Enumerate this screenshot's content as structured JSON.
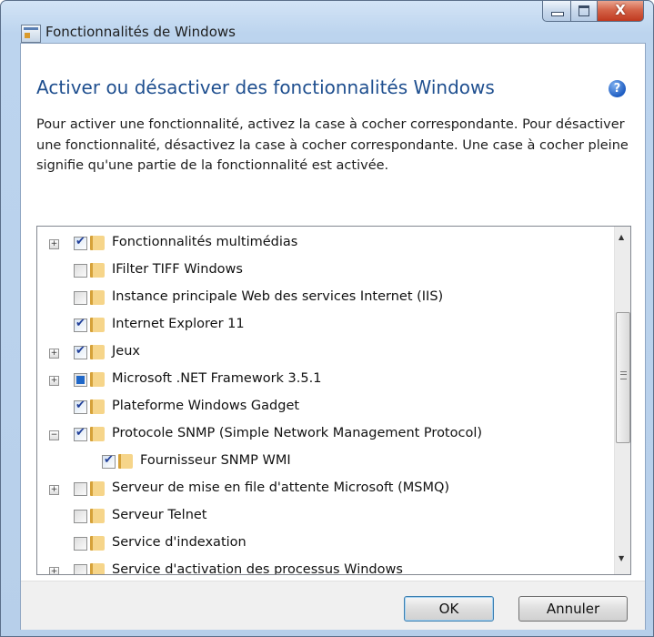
{
  "window": {
    "title": "Fonctionnalités de Windows",
    "close_glyph": "X"
  },
  "heading": "Activer ou désactiver des fonctionnalités Windows",
  "help_glyph": "?",
  "description": "Pour activer une fonctionnalité, activez la case à cocher correspondante. Pour désactiver une fonctionnalité, désactivez la case à cocher correspondante. Une case à cocher pleine signifie qu'une partie de la fonctionnalité est activée.",
  "features": [
    {
      "label": "Fonctionnalités multimédias",
      "state": "checked",
      "expander": "+",
      "level": 0
    },
    {
      "label": "IFilter TIFF Windows",
      "state": "unchecked",
      "expander": "",
      "level": 0
    },
    {
      "label": "Instance principale Web des services Internet (IIS)",
      "state": "unchecked",
      "expander": "",
      "level": 0
    },
    {
      "label": "Internet Explorer 11",
      "state": "checked",
      "expander": "",
      "level": 0
    },
    {
      "label": "Jeux",
      "state": "checked",
      "expander": "+",
      "level": 0
    },
    {
      "label": "Microsoft .NET Framework 3.5.1",
      "state": "partial",
      "expander": "+",
      "level": 0
    },
    {
      "label": "Plateforme Windows Gadget",
      "state": "checked",
      "expander": "",
      "level": 0
    },
    {
      "label": "Protocole SNMP (Simple Network Management Protocol)",
      "state": "checked",
      "expander": "−",
      "level": 0
    },
    {
      "label": "Fournisseur SNMP WMI",
      "state": "checked",
      "expander": "",
      "level": 1
    },
    {
      "label": "Serveur de mise en file d'attente Microsoft (MSMQ)",
      "state": "unchecked",
      "expander": "+",
      "level": 0
    },
    {
      "label": "Serveur Telnet",
      "state": "unchecked",
      "expander": "",
      "level": 0
    },
    {
      "label": "Service d'indexation",
      "state": "unchecked",
      "expander": "",
      "level": 0
    },
    {
      "label": "Service d'activation des processus Windows",
      "state": "unchecked",
      "expander": "+",
      "level": 0
    }
  ],
  "buttons": {
    "ok": "OK",
    "cancel": "Annuler"
  }
}
